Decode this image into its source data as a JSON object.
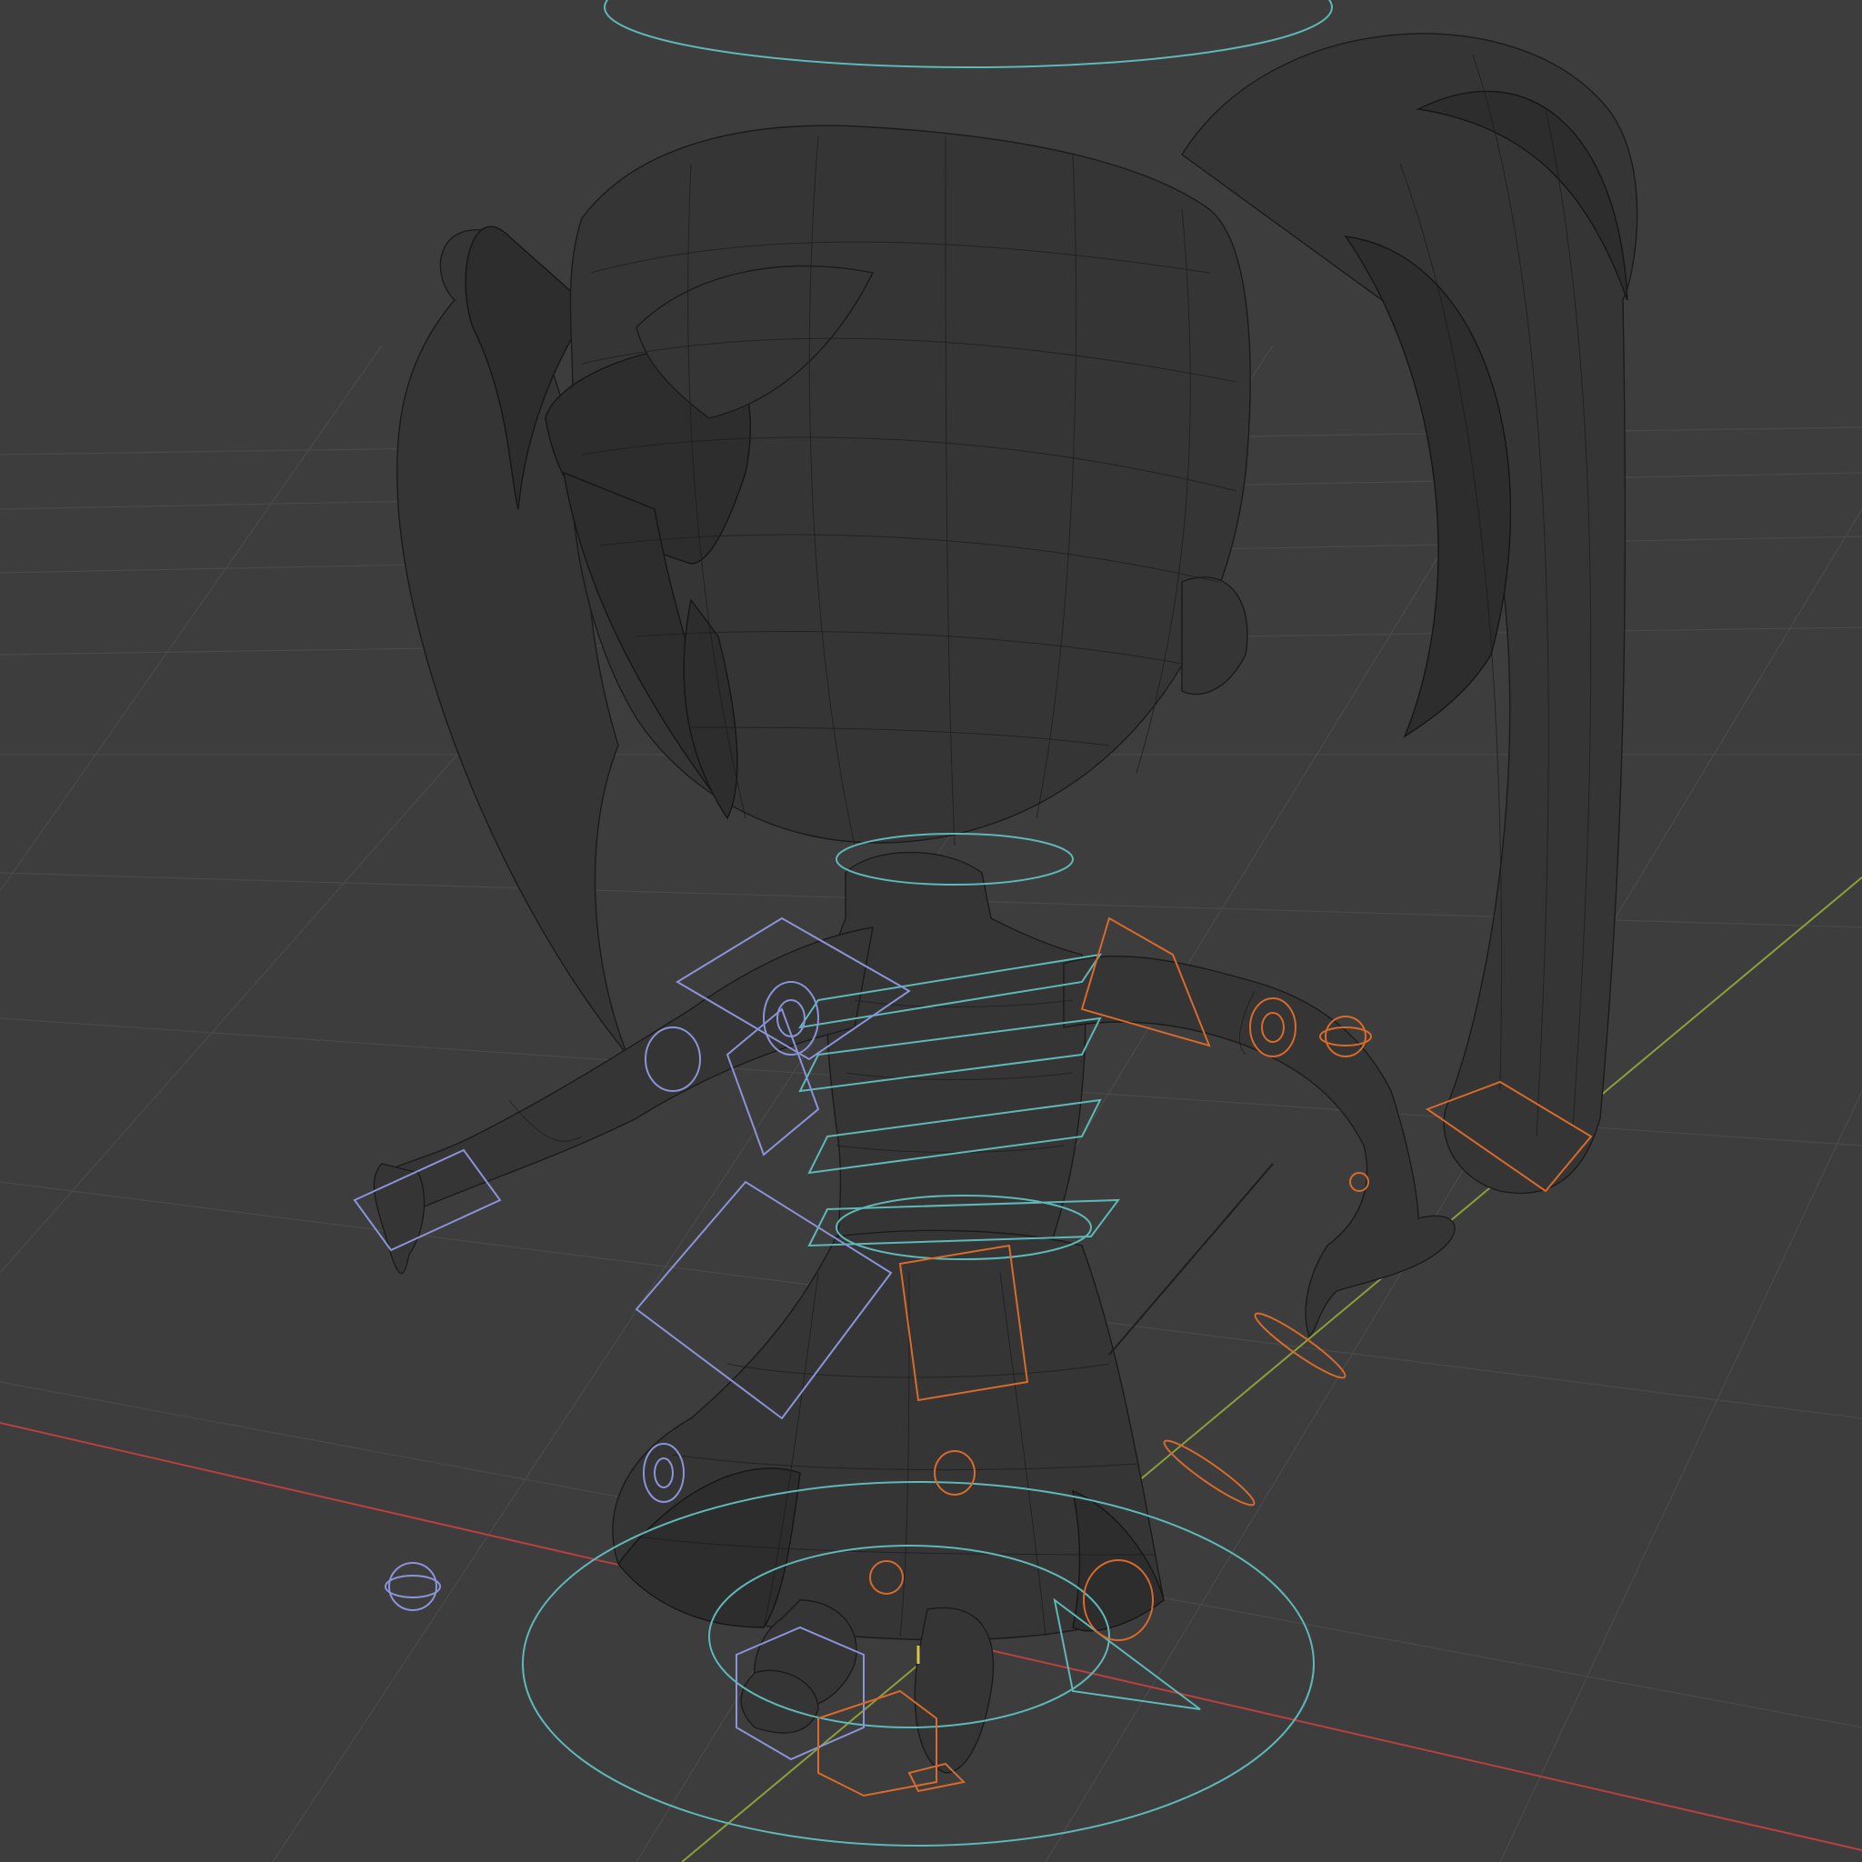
{
  "viewport": {
    "mode": "wireframe",
    "background": "#3d3d3d",
    "grid_color": "#4a4a4a",
    "axis_colors": {
      "x": "#b84040",
      "y": "#8aa03a"
    },
    "mesh_wire_color": "#1b1b1b",
    "control_colors": {
      "root": "#5fb8b8",
      "right_side": "#d86a2a",
      "left_side": "#8a94d8"
    }
  }
}
